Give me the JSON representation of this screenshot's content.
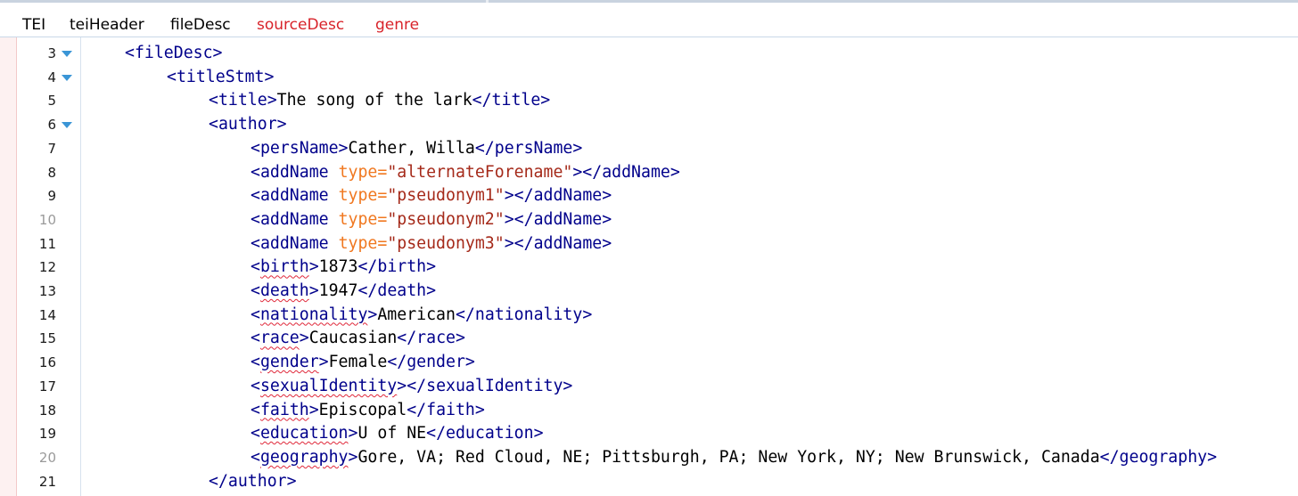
{
  "breadcrumb": {
    "items": [
      {
        "label": "TEI",
        "color": "#000000"
      },
      {
        "label": "teiHeader",
        "color": "#000000"
      },
      {
        "label": "fileDesc",
        "color": "#000000"
      },
      {
        "label": "sourceDesc",
        "color": "#d8232a"
      },
      {
        "label": "genre",
        "color": "#d8232a"
      }
    ]
  },
  "colors": {
    "tag": "#00008b",
    "attribute_name": "#f07820",
    "attribute_value": "#a52a1a",
    "text": "#000000",
    "spell_error": "#e0283a",
    "fold_marker": "#3a95d6"
  },
  "editor": {
    "lines": [
      {
        "number": "3",
        "foldable": true,
        "indent": 0,
        "tokens": [
          {
            "t": "tag",
            "v": "<fileDesc>"
          }
        ]
      },
      {
        "number": "4",
        "foldable": true,
        "indent": 1,
        "tokens": [
          {
            "t": "tag",
            "v": "<titleStmt>"
          }
        ]
      },
      {
        "number": "5",
        "foldable": false,
        "indent": 2,
        "tokens": [
          {
            "t": "tag",
            "v": "<title>"
          },
          {
            "t": "text",
            "v": "The song of the lark"
          },
          {
            "t": "tag",
            "v": "</title>"
          }
        ]
      },
      {
        "number": "6",
        "foldable": true,
        "indent": 2,
        "tokens": [
          {
            "t": "tag",
            "v": "<author>"
          }
        ]
      },
      {
        "number": "7",
        "foldable": false,
        "indent": 3,
        "tokens": [
          {
            "t": "tag",
            "v": "<persName>"
          },
          {
            "t": "text",
            "v": "Cather, Willa"
          },
          {
            "t": "tag",
            "v": "</persName>"
          }
        ]
      },
      {
        "number": "8",
        "foldable": false,
        "indent": 3,
        "tokens": [
          {
            "t": "tag",
            "v": "<addName "
          },
          {
            "t": "attr",
            "v": "type="
          },
          {
            "t": "val",
            "v": "\"alternateForename\""
          },
          {
            "t": "tag",
            "v": "></addName>"
          }
        ]
      },
      {
        "number": "9",
        "foldable": false,
        "indent": 3,
        "tokens": [
          {
            "t": "tag",
            "v": "<addName "
          },
          {
            "t": "attr",
            "v": "type="
          },
          {
            "t": "val",
            "v": "\"pseudonym1\""
          },
          {
            "t": "tag",
            "v": "></addName>"
          }
        ]
      },
      {
        "number": "10",
        "foldable": false,
        "indent": 3,
        "tokens": [
          {
            "t": "tag",
            "v": "<addName "
          },
          {
            "t": "attr",
            "v": "type="
          },
          {
            "t": "val",
            "v": "\"pseudonym2\""
          },
          {
            "t": "tag",
            "v": "></addName>"
          }
        ]
      },
      {
        "number": "11",
        "foldable": false,
        "indent": 3,
        "tokens": [
          {
            "t": "tag",
            "v": "<addName "
          },
          {
            "t": "attr",
            "v": "type="
          },
          {
            "t": "val",
            "v": "\"pseudonym3\""
          },
          {
            "t": "tag",
            "v": "></addName>"
          }
        ]
      },
      {
        "number": "12",
        "foldable": false,
        "indent": 3,
        "tokens": [
          {
            "t": "tag",
            "v": "<"
          },
          {
            "t": "tag-err",
            "v": "birth"
          },
          {
            "t": "tag",
            "v": ">"
          },
          {
            "t": "text",
            "v": "1873"
          },
          {
            "t": "tag",
            "v": "</birth>"
          }
        ]
      },
      {
        "number": "13",
        "foldable": false,
        "indent": 3,
        "tokens": [
          {
            "t": "tag",
            "v": "<"
          },
          {
            "t": "tag-err",
            "v": "death"
          },
          {
            "t": "tag",
            "v": ">"
          },
          {
            "t": "text",
            "v": "1947"
          },
          {
            "t": "tag",
            "v": "</death>"
          }
        ]
      },
      {
        "number": "14",
        "foldable": false,
        "indent": 3,
        "tokens": [
          {
            "t": "tag",
            "v": "<"
          },
          {
            "t": "tag-err",
            "v": "nationality"
          },
          {
            "t": "tag",
            "v": ">"
          },
          {
            "t": "text",
            "v": "American"
          },
          {
            "t": "tag",
            "v": "</nationality>"
          }
        ]
      },
      {
        "number": "15",
        "foldable": false,
        "indent": 3,
        "tokens": [
          {
            "t": "tag",
            "v": "<"
          },
          {
            "t": "tag-err",
            "v": "race"
          },
          {
            "t": "tag",
            "v": ">"
          },
          {
            "t": "text",
            "v": "Caucasian"
          },
          {
            "t": "tag",
            "v": "</race>"
          }
        ]
      },
      {
        "number": "16",
        "foldable": false,
        "indent": 3,
        "tokens": [
          {
            "t": "tag",
            "v": "<"
          },
          {
            "t": "tag-err",
            "v": "gender"
          },
          {
            "t": "tag",
            "v": ">"
          },
          {
            "t": "text",
            "v": "Female"
          },
          {
            "t": "tag",
            "v": "</gender>"
          }
        ]
      },
      {
        "number": "17",
        "foldable": false,
        "indent": 3,
        "tokens": [
          {
            "t": "tag",
            "v": "<"
          },
          {
            "t": "tag-err",
            "v": "sexualIdentity"
          },
          {
            "t": "tag",
            "v": ">"
          },
          {
            "t": "tag",
            "v": "</sexualIdentity>"
          }
        ]
      },
      {
        "number": "18",
        "foldable": false,
        "indent": 3,
        "tokens": [
          {
            "t": "tag",
            "v": "<"
          },
          {
            "t": "tag-err",
            "v": "faith"
          },
          {
            "t": "tag",
            "v": ">"
          },
          {
            "t": "text",
            "v": "Episcopal"
          },
          {
            "t": "tag",
            "v": "</faith>"
          }
        ]
      },
      {
        "number": "19",
        "foldable": false,
        "indent": 3,
        "tokens": [
          {
            "t": "tag",
            "v": "<"
          },
          {
            "t": "tag-err",
            "v": "education"
          },
          {
            "t": "tag",
            "v": ">"
          },
          {
            "t": "text",
            "v": "U of NE"
          },
          {
            "t": "tag",
            "v": "</education>"
          }
        ]
      },
      {
        "number": "20",
        "foldable": false,
        "indent": 3,
        "tokens": [
          {
            "t": "tag",
            "v": "<"
          },
          {
            "t": "tag-err",
            "v": "geography"
          },
          {
            "t": "tag",
            "v": ">"
          },
          {
            "t": "text",
            "v": "Gore, VA; Red Cloud, NE; Pittsburgh, PA; New York, NY; New Brunswick, Canada"
          },
          {
            "t": "tag",
            "v": "</geography>"
          }
        ]
      },
      {
        "number": "21",
        "foldable": false,
        "indent": 2,
        "tokens": [
          {
            "t": "tag",
            "v": "</author>"
          }
        ]
      }
    ]
  }
}
